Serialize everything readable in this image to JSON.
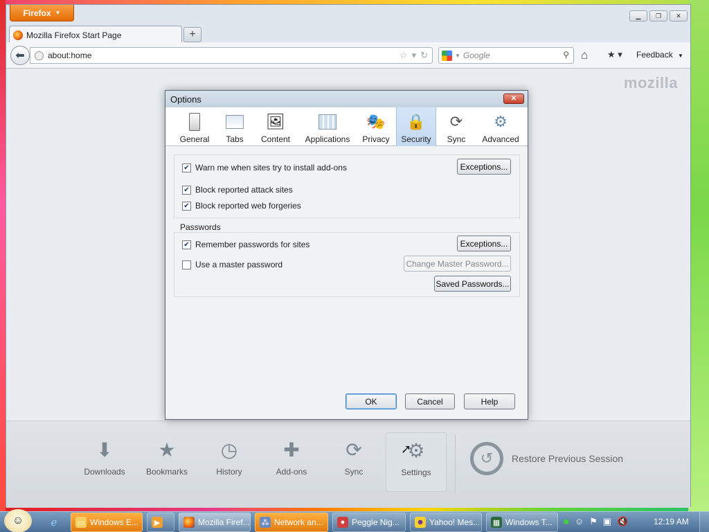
{
  "browser": {
    "menu_button": "Firefox",
    "tab_title": "Mozilla Firefox Start Page",
    "url": "about:home",
    "search_placeholder": "Google",
    "feedback_label": "Feedback",
    "brand_word": "mozilla"
  },
  "launcher": {
    "items": [
      {
        "label": "Downloads",
        "icon": "download-icon"
      },
      {
        "label": "Bookmarks",
        "icon": "star-icon"
      },
      {
        "label": "History",
        "icon": "clock-icon"
      },
      {
        "label": "Add-ons",
        "icon": "puzzle-icon"
      },
      {
        "label": "Sync",
        "icon": "sync-icon"
      },
      {
        "label": "Settings",
        "icon": "gear-icon"
      }
    ],
    "restore_label": "Restore Previous Session"
  },
  "dialog": {
    "title": "Options",
    "close_label": "✕",
    "panes": [
      {
        "label": "General",
        "icon": "switch-icon"
      },
      {
        "label": "Tabs",
        "icon": "tabs-icon"
      },
      {
        "label": "Content",
        "icon": "content-icon"
      },
      {
        "label": "Applications",
        "icon": "applications-icon"
      },
      {
        "label": "Privacy",
        "icon": "mask-icon"
      },
      {
        "label": "Security",
        "icon": "lock-icon"
      },
      {
        "label": "Sync",
        "icon": "sync-icon"
      },
      {
        "label": "Advanced",
        "icon": "gear-icon"
      }
    ],
    "active_pane": "Security",
    "warn_addons": {
      "label": "Warn me when sites try to install add-ons",
      "checked": true
    },
    "addons_exceptions": "Exceptions...",
    "block_attack": {
      "label": "Block reported attack sites",
      "checked": true
    },
    "block_forgeries": {
      "label": "Block reported web forgeries",
      "checked": true
    },
    "passwords_heading": "Passwords",
    "remember_passwords": {
      "label": "Remember passwords for sites",
      "checked": true
    },
    "passwords_exceptions": "Exceptions...",
    "master_password": {
      "label": "Use a master password",
      "checked": false
    },
    "change_master": "Change Master Password...",
    "saved_passwords": "Saved Passwords...",
    "ok": "OK",
    "cancel": "Cancel",
    "help": "Help"
  },
  "taskbar": {
    "items": [
      {
        "label": "Windows E...",
        "icon": "folder-icon"
      },
      {
        "label": "",
        "icon": "media-icon"
      },
      {
        "label": "Mozilla Firef...",
        "icon": "firefox-icon"
      },
      {
        "label": "Network an...",
        "icon": "network-icon"
      },
      {
        "label": "Peggle Nig...",
        "icon": "game-icon"
      },
      {
        "label": "Yahoo! Mes...",
        "icon": "messenger-icon"
      },
      {
        "label": "Windows T...",
        "icon": "taskmgr-icon"
      }
    ],
    "clock": "12:19 AM"
  }
}
